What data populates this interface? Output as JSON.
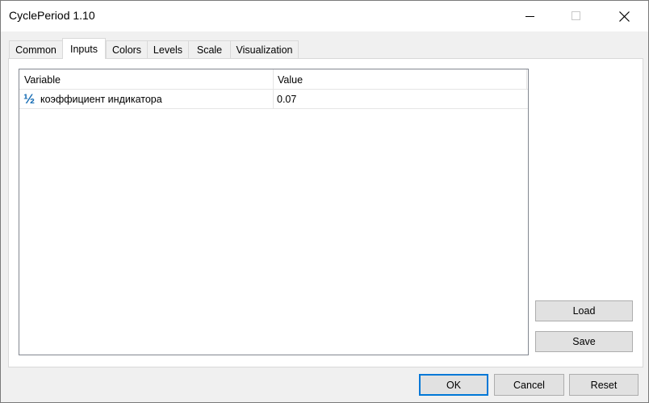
{
  "window": {
    "title": "CyclePeriod 1.10"
  },
  "tabs": [
    "Common",
    "Inputs",
    "Colors",
    "Levels",
    "Scale",
    "Visualization"
  ],
  "active_tab": "Inputs",
  "grid": {
    "columns": [
      "Variable",
      "Value"
    ],
    "rows": [
      {
        "icon": "fraction-icon",
        "icon_glyph": "½",
        "variable": "коэффициент индикатора",
        "value": "0.07"
      }
    ]
  },
  "side_buttons": {
    "load": "Load",
    "save": "Save"
  },
  "footer_buttons": {
    "ok": "OK",
    "cancel": "Cancel",
    "reset": "Reset"
  },
  "colors": {
    "accent": "#0078d7",
    "icon": "#1a6fb5"
  }
}
